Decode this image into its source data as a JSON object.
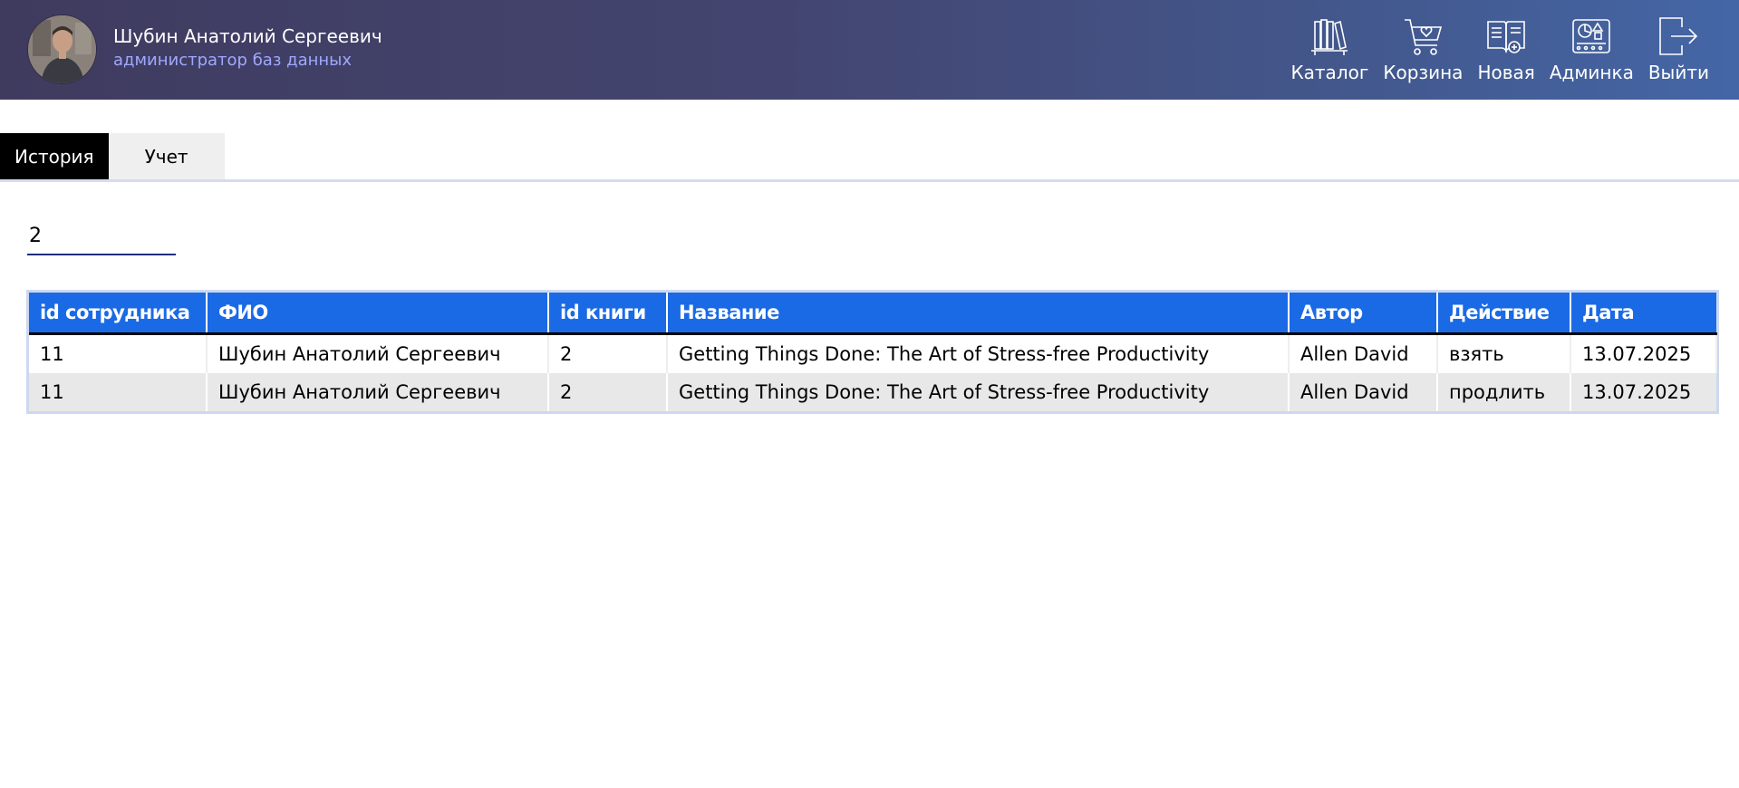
{
  "user": {
    "name": "Шубин Анатолий Сергеевич",
    "role": "администратор баз данных"
  },
  "nav": [
    {
      "label": "Каталог",
      "icon": "books-icon"
    },
    {
      "label": "Корзина",
      "icon": "cart-heart-icon"
    },
    {
      "label": "Новая",
      "icon": "new-book-icon"
    },
    {
      "label": "Админка",
      "icon": "admin-dashboard-icon"
    },
    {
      "label": "Выйти",
      "icon": "logout-icon"
    }
  ],
  "tabs": [
    {
      "label": "История",
      "active": true
    },
    {
      "label": "Учет",
      "active": false
    }
  ],
  "search": {
    "value": "2"
  },
  "table": {
    "headers": [
      "id сотрудника",
      "ФИО",
      "id книги",
      "Название",
      "Автор",
      "Действие",
      "Дата"
    ],
    "rows": [
      [
        "11",
        "Шубин Анатолий Сергеевич",
        "2",
        "Getting Things Done: The Art of Stress-free Productivity",
        "Allen David",
        "взять",
        "13.07.2025"
      ],
      [
        "11",
        "Шубин Анатолий Сергеевич",
        "2",
        "Getting Things Done: The Art of Stress-free Productivity",
        "Allen David",
        "продлить",
        "13.07.2025"
      ]
    ]
  },
  "colors": {
    "header_gradient_start": "#3f3b5f",
    "header_gradient_end": "#4466a6",
    "role_text": "#9fa8ff",
    "table_header": "#1a6ae6",
    "row_alt": "#e8e8e8",
    "active_tab": "#000000",
    "inactive_tab": "#efefef"
  }
}
